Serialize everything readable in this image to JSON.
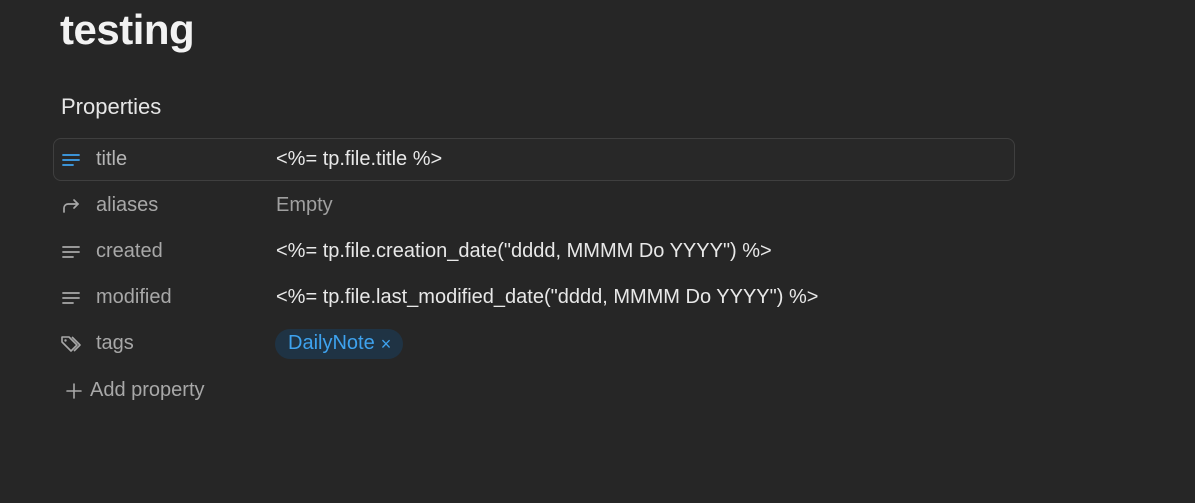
{
  "note": {
    "title": "testing"
  },
  "properties": {
    "heading": "Properties",
    "rows": [
      {
        "key": "title",
        "value": "<%= tp.file.title %>",
        "icon": "text-lines-icon"
      },
      {
        "key": "aliases",
        "value": "Empty",
        "icon": "forward-arrow-icon"
      },
      {
        "key": "created",
        "value": "<%= tp.file.creation_date(\"dddd, MMMM Do YYYY\") %>",
        "icon": "text-lines-icon"
      },
      {
        "key": "modified",
        "value": "<%= tp.file.last_modified_date(\"dddd, MMMM Do YYYY\") %>",
        "icon": "text-lines-icon"
      },
      {
        "key": "tags",
        "icon": "tags-icon",
        "tags": [
          {
            "label": "DailyNote",
            "remove": "×"
          }
        ]
      }
    ],
    "add_label": "Add property"
  },
  "colors": {
    "background": "#262626",
    "accent": "#3ea2ee",
    "tag_bg": "#1f3344"
  }
}
